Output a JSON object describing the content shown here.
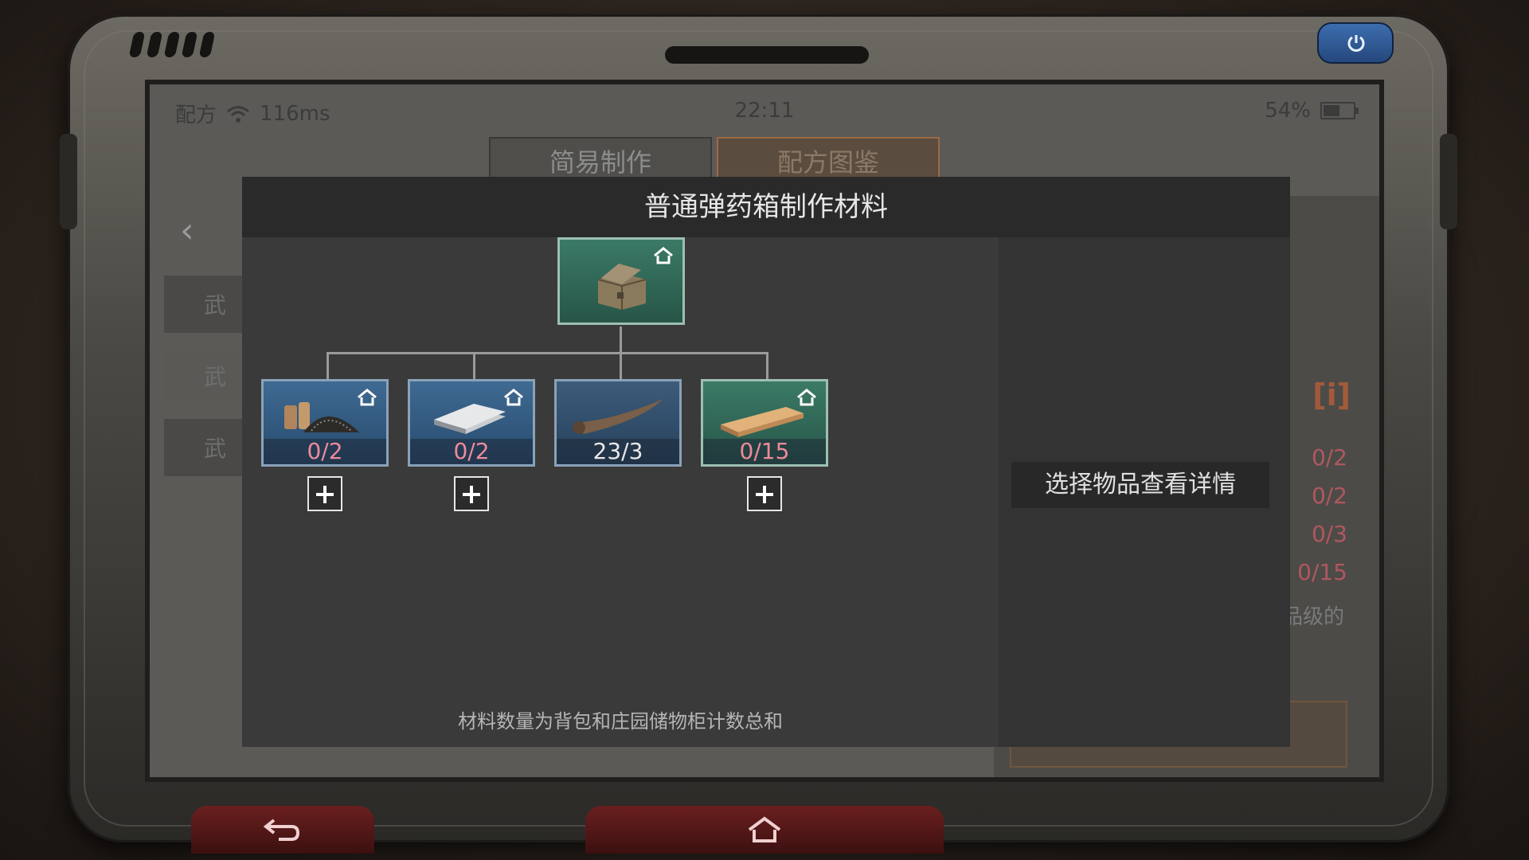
{
  "status": {
    "carrier": "配方",
    "ping": "116ms",
    "time": "22:11",
    "battery": "54%"
  },
  "tabs": [
    {
      "label": "简易制作"
    },
    {
      "label": "配方图鉴"
    }
  ],
  "sidebar": {
    "items": [
      {
        "label": "武"
      },
      {
        "label": "武"
      },
      {
        "label": "武"
      }
    ]
  },
  "dialog": {
    "title": "普通弹药箱制作材料",
    "result_item": {
      "name_icon": "ammo-box-icon"
    },
    "materials": [
      {
        "icon": "gunpowder-icon",
        "count": "0/2"
      },
      {
        "icon": "metal-plate-icon",
        "count": "0/2"
      },
      {
        "icon": "horn-icon",
        "count": "23/3"
      },
      {
        "icon": "wood-plank-icon",
        "count": "0/15"
      }
    ],
    "footnote": "材料数量为背包和庄园储物柜计数总和",
    "detail_hint": "选择物品查看详情"
  },
  "background_panel": {
    "info_icon": "[i]",
    "counts": [
      "0/2",
      "0/2",
      "0/3",
      "0/15"
    ],
    "grade_text": "品级的"
  },
  "colors": {
    "accent_orange": "#9b6a42",
    "count_red": "#ee8a9a",
    "item_blue": "#3f6a92",
    "item_green": "#3b7a66"
  }
}
